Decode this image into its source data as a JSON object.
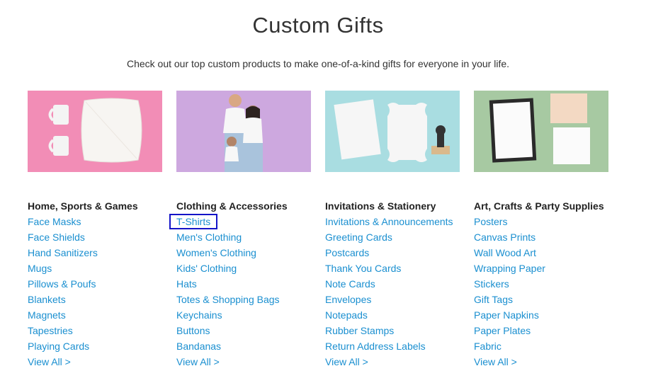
{
  "title": "Custom Gifts",
  "subtitle": "Check out our top custom products to make one-of-a-kind gifts for everyone in your life.",
  "colors": {
    "link": "#1a8fd0",
    "focus": "#1414c8",
    "heading": "#222222"
  },
  "categories": [
    {
      "heading": "Home, Sports & Games",
      "image": "mugs-and-pillow",
      "links": [
        "Face Masks",
        "Face Shields",
        "Hand Sanitizers",
        "Mugs",
        "Pillows & Poufs",
        "Blankets",
        "Magnets",
        "Tapestries",
        "Playing Cards",
        "View All >"
      ]
    },
    {
      "heading": "Clothing & Accessories",
      "image": "family-in-white-tshirts",
      "links": [
        "T-Shirts",
        "Men's Clothing",
        "Women's Clothing",
        "Kids' Clothing",
        "Hats",
        "Totes & Shopping Bags",
        "Keychains",
        "Buttons",
        "Bandanas",
        "View All >"
      ]
    },
    {
      "heading": "Invitations & Stationery",
      "image": "cards-and-stamp",
      "links": [
        "Invitations & Announcements",
        "Greeting Cards",
        "Postcards",
        "Thank You Cards",
        "Note Cards",
        "Envelopes",
        "Notepads",
        "Rubber Stamps",
        "Return Address Labels",
        "View All >"
      ]
    },
    {
      "heading": "Art, Crafts & Party Supplies",
      "image": "framed-prints",
      "links": [
        "Posters",
        "Canvas Prints",
        "Wall Wood Art",
        "Wrapping Paper",
        "Stickers",
        "Gift Tags",
        "Paper Napkins",
        "Paper Plates",
        "Fabric",
        "View All >"
      ]
    }
  ]
}
